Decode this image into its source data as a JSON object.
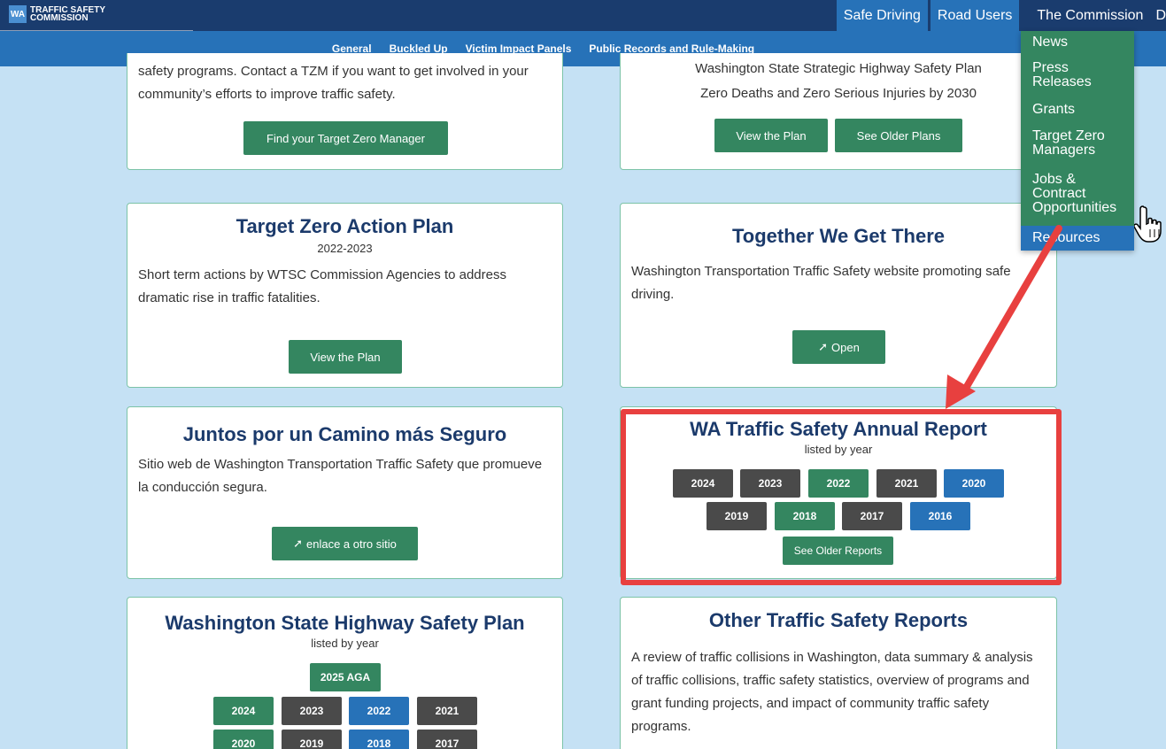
{
  "header": {
    "logo_mark": "WA",
    "logo_line1": "TRAFFIC SAFETY",
    "logo_line2": "COMMISSION",
    "nav": [
      "Safe Driving",
      "Road Users",
      "The Commission",
      "D"
    ]
  },
  "subnav": [
    "General",
    "Buckled Up",
    "Victim Impact Panels",
    "Public Records and Rule-Making"
  ],
  "dropdown": {
    "items": [
      "News",
      "Press Releases",
      "Grants",
      "Target Zero Managers",
      "Jobs & Contract Opportunities",
      "Resources"
    ],
    "active": "Resources"
  },
  "cards": {
    "tzm": {
      "text": "safety programs. Contact a TZM if you want to get involved in your community’s efforts to improve traffic safety.",
      "button": "Find your Target Zero Manager"
    },
    "shsp": {
      "line1": "Washington State Strategic Highway Safety Plan",
      "line2": "Zero Deaths and Zero Serious Injuries by 2030",
      "btn1": "View the Plan",
      "btn2": "See Older Plans"
    },
    "action": {
      "title": "Target Zero Action Plan",
      "subtitle": "2022-2023",
      "text": "Short term actions by WTSC Commission Agencies to address dramatic rise in traffic fatalities.",
      "button": "View the Plan"
    },
    "together": {
      "title": "Together We Get There",
      "text": "Washington Transportation Traffic Safety website promoting safe driving.",
      "button": "Open"
    },
    "juntos": {
      "title": "Juntos por un Camino más Seguro",
      "text": "Sitio web de Washington Transportation Traffic Safety que promueve la conducción segura.",
      "button": "enlace a otro sitio"
    },
    "annual": {
      "title": "WA Traffic Safety Annual Report",
      "subtitle": "listed by year",
      "years": [
        "2024",
        "2023",
        "2022",
        "2021",
        "2020",
        "2019",
        "2018",
        "2017",
        "2016"
      ],
      "older": "See Older Reports"
    },
    "hsp": {
      "title": "Washington State Highway Safety Plan",
      "subtitle": "listed by year",
      "aga": "2025 AGA",
      "years": [
        "2024",
        "2023",
        "2022",
        "2021",
        "2020",
        "2019",
        "2018",
        "2017"
      ]
    },
    "other": {
      "title": "Other Traffic Safety Reports",
      "text": "A review of traffic collisions in Washington, data summary & analysis of traffic collisions, traffic safety statistics, overview of programs and grant funding projects, and impact of community traffic safety programs."
    }
  },
  "colors": {
    "navy": "#1a3c6e",
    "blue": "#2772b8",
    "green": "#348660",
    "gray": "#4a4a4a",
    "annotation": "#e8403f"
  },
  "icons": [
    "external-link-icon",
    "pointer-hand-icon"
  ]
}
